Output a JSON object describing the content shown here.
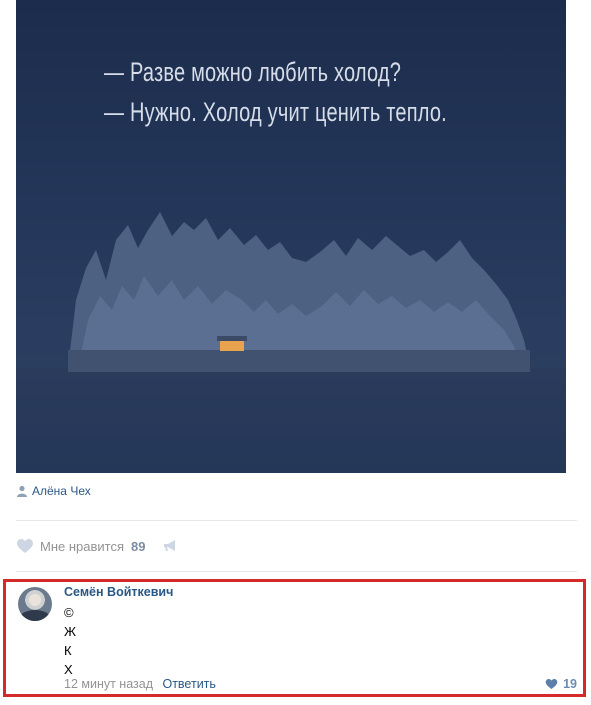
{
  "post": {
    "quote_line1": "— Разве можно любить холод?",
    "quote_line2": "— Нужно. Холод учит ценить тепло.",
    "author": "Алёна Чех",
    "like_label": "Мне нравится",
    "like_count": "89"
  },
  "comment": {
    "name": "Семён Войткевич",
    "lines": [
      "©",
      "Ж",
      "К",
      "Х"
    ],
    "time": "12 минут назад",
    "reply": "Ответить",
    "likes": "19"
  },
  "colors": {
    "link": "#2a5885",
    "muted": "#939393",
    "highlight": "#d42a2a",
    "night_sky": "#24375a"
  },
  "icons": {
    "author": "user-icon",
    "like": "heart-icon",
    "share": "megaphone-icon",
    "comment_like": "heart-icon"
  }
}
